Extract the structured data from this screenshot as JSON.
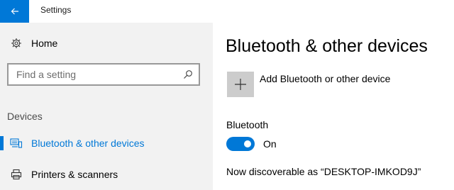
{
  "window": {
    "title": "Settings"
  },
  "sidebar": {
    "home_label": "Home",
    "search": {
      "placeholder": "Find a setting"
    },
    "group_header": "Devices",
    "items": [
      {
        "label": "Bluetooth & other devices",
        "icon": "bluetooth-devices-icon",
        "selected": true
      },
      {
        "label": "Printers & scanners",
        "icon": "printer-icon",
        "selected": false
      }
    ]
  },
  "main": {
    "title": "Bluetooth & other devices",
    "add_device_label": "Add Bluetooth or other device",
    "bluetooth": {
      "label": "Bluetooth",
      "toggle_state": "On",
      "discoverable_text": "Now discoverable as “DESKTOP-IMKOD9J”"
    }
  },
  "colors": {
    "accent": "#0078d7",
    "sidebar_bg": "#f2f2f2",
    "tile_bg": "#cccccc"
  }
}
